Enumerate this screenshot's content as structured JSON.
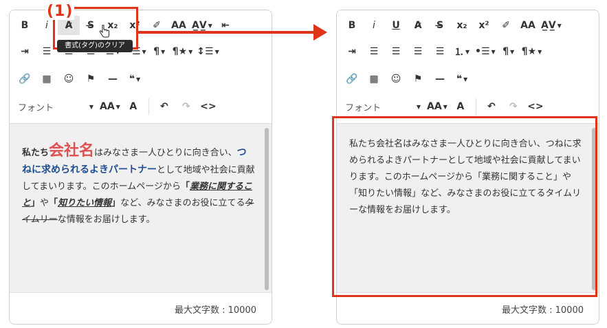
{
  "annotation": {
    "step_label": "(1)",
    "tooltip": "書式(タグ)のクリア",
    "accent_color": "#e0341a"
  },
  "toolbar": {
    "row1": [
      {
        "name": "bold-button",
        "label": "B"
      },
      {
        "name": "italic-button",
        "label": "i"
      },
      {
        "name": "underline-button",
        "label": "U"
      },
      {
        "name": "clear-format-button",
        "label": "A̷"
      },
      {
        "name": "strikethrough-button",
        "label": "S̶"
      },
      {
        "name": "subscript-button",
        "label": "x₂"
      },
      {
        "name": "superscript-button",
        "label": "x²"
      },
      {
        "name": "highlighter-button",
        "label": "✐"
      },
      {
        "name": "font-size-adjust-button",
        "label": "AA"
      },
      {
        "name": "letter-spacing-button",
        "label": "A̲V̲"
      },
      {
        "name": "outdent-button",
        "label": "⇤"
      }
    ],
    "row2": [
      {
        "name": "indent-button",
        "label": "⇥"
      },
      {
        "name": "align-left-button",
        "label": "☰"
      },
      {
        "name": "align-center-button",
        "label": "☰"
      },
      {
        "name": "align-right-button",
        "label": "☰"
      },
      {
        "name": "align-justify-button",
        "label": "☰"
      },
      {
        "name": "ordered-list-button",
        "label": "⒈"
      },
      {
        "name": "unordered-list-button",
        "label": "•☰"
      },
      {
        "name": "paragraph-button",
        "label": "¶"
      },
      {
        "name": "paragraph-style-button",
        "label": "¶★"
      },
      {
        "name": "line-height-button",
        "label": "↕☰"
      }
    ],
    "row3": [
      {
        "name": "link-button",
        "label": "🔗"
      },
      {
        "name": "table-button",
        "label": "▦"
      },
      {
        "name": "emoji-button",
        "label": "☺"
      },
      {
        "name": "flag-button",
        "label": "⚑"
      },
      {
        "name": "horizontal-rule-button",
        "label": "—"
      },
      {
        "name": "quote-button",
        "label": "❝"
      }
    ],
    "font_placeholder": "フォント",
    "font_size_label": "AA",
    "color_label": "A",
    "undo_label": "↶",
    "redo_label": "↷",
    "code_view_label": "<>"
  },
  "left_content": {
    "p1": "私たち",
    "p2": "会社名",
    "p3": "はみなさま一人ひとりに向き合い、",
    "p4": "つねに求められるよきパートナー",
    "p5": "として地域や社会に貢献してまいります。このホームページから",
    "p6": "「",
    "p7": "業務に関すること",
    "p8": "」",
    "p9": "や",
    "p10": "「",
    "p11": "知りたい情報",
    "p12": "」",
    "p13": "など、みなさまのお役に立てる",
    "p14": "タイムリー",
    "p15": "な情報をお届けします。"
  },
  "right_content": {
    "text": "私たち会社名はみなさま一人ひとりに向き合い、つねに求められるよきパートナーとして地域や社会に貢献してまいります。このホームページから「業務に関すること」や「知りたい情報」など、みなさまのお役に立てるタイムリーな情報をお届けします。"
  },
  "footer": {
    "counter": "最大文字数 : 10000"
  }
}
